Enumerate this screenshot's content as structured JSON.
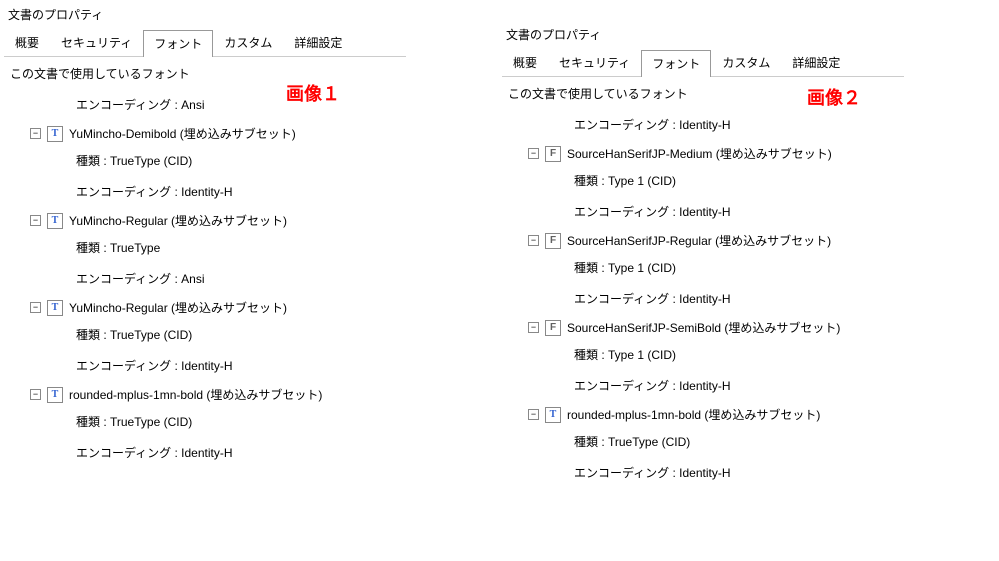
{
  "left": {
    "window_title": "文書のプロパティ",
    "tabs": [
      {
        "label": "概要",
        "active": false
      },
      {
        "label": "セキュリティ",
        "active": false
      },
      {
        "label": "フォント",
        "active": true
      },
      {
        "label": "カスタム",
        "active": false
      },
      {
        "label": "詳細設定",
        "active": false
      }
    ],
    "section_label": "この文書で使用しているフォント",
    "overlay": "画像１",
    "first_child": "エンコーディング : Ansi",
    "fonts": [
      {
        "icon": "t",
        "name": "YuMincho-Demibold (埋め込みサブセット)",
        "children": [
          "種類 : TrueType (CID)",
          "エンコーディング : Identity-H"
        ]
      },
      {
        "icon": "t",
        "name": "YuMincho-Regular (埋め込みサブセット)",
        "children": [
          "種類 : TrueType",
          "エンコーディング : Ansi"
        ]
      },
      {
        "icon": "t",
        "name": "YuMincho-Regular (埋め込みサブセット)",
        "children": [
          "種類 : TrueType (CID)",
          "エンコーディング : Identity-H"
        ]
      },
      {
        "icon": "t",
        "name": "rounded-mplus-1mn-bold (埋め込みサブセット)",
        "children": [
          "種類 : TrueType (CID)",
          "エンコーディング : Identity-H"
        ]
      }
    ]
  },
  "right": {
    "window_title": "文書のプロパティ",
    "tabs": [
      {
        "label": "概要",
        "active": false
      },
      {
        "label": "セキュリティ",
        "active": false
      },
      {
        "label": "フォント",
        "active": true
      },
      {
        "label": "カスタム",
        "active": false
      },
      {
        "label": "詳細設定",
        "active": false
      }
    ],
    "section_label": "この文書で使用しているフォント",
    "overlay": "画像２",
    "first_child": "エンコーディング : Identity-H",
    "fonts": [
      {
        "icon": "f",
        "name": "SourceHanSerifJP-Medium (埋め込みサブセット)",
        "children": [
          "種類 : Type 1 (CID)",
          "エンコーディング : Identity-H"
        ]
      },
      {
        "icon": "f",
        "name": "SourceHanSerifJP-Regular (埋め込みサブセット)",
        "children": [
          "種類 : Type 1 (CID)",
          "エンコーディング : Identity-H"
        ]
      },
      {
        "icon": "f",
        "name": "SourceHanSerifJP-SemiBold (埋め込みサブセット)",
        "children": [
          "種類 : Type 1 (CID)",
          "エンコーディング : Identity-H"
        ]
      },
      {
        "icon": "t",
        "name": "rounded-mplus-1mn-bold (埋め込みサブセット)",
        "children": [
          "種類 : TrueType (CID)",
          "エンコーディング : Identity-H"
        ]
      }
    ]
  }
}
